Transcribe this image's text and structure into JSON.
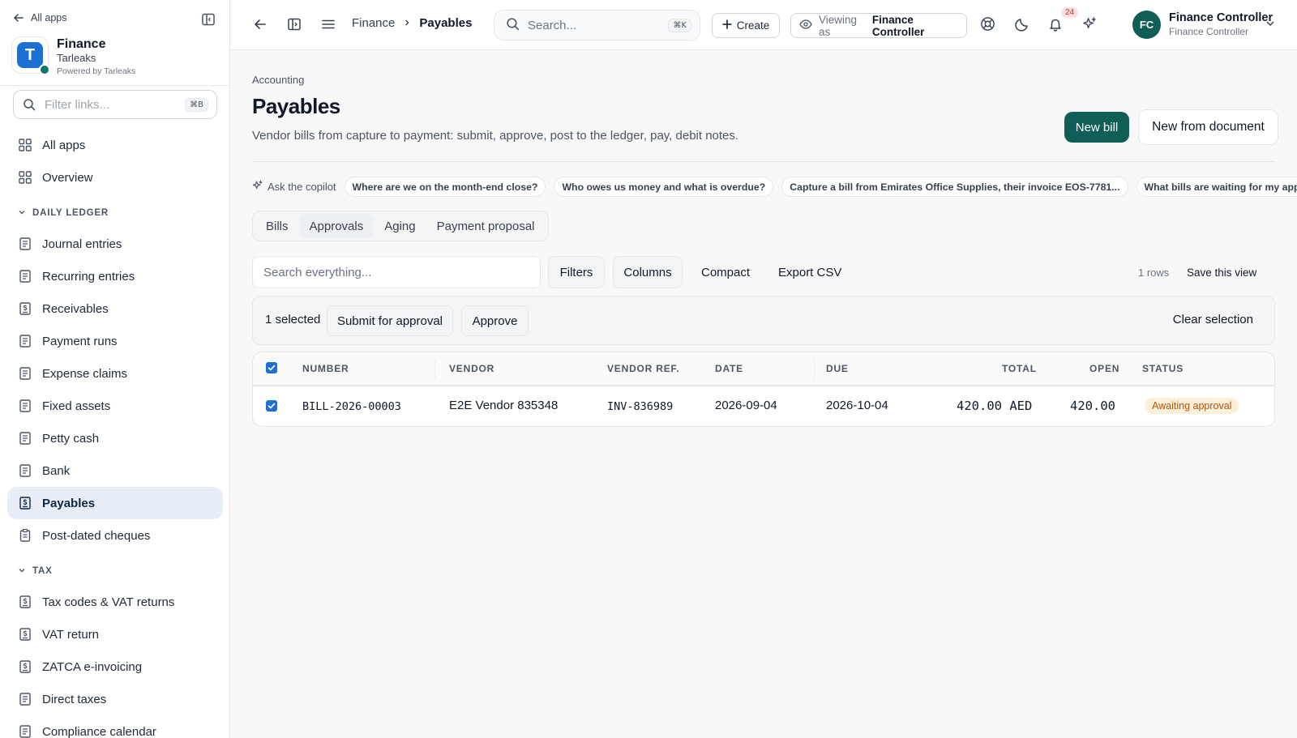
{
  "sidebar": {
    "back_label": "All apps",
    "brand": {
      "logo_letter": "T",
      "name": "Finance",
      "org": "Tarleaks",
      "powered_by": "Powered by Tarleaks"
    },
    "filter": {
      "placeholder": "Filter links...",
      "shortcut": "⌘B"
    },
    "top_items": [
      {
        "label": "All apps",
        "icon": "grid-icon"
      },
      {
        "label": "Overview",
        "icon": "grid-icon"
      }
    ],
    "sections": [
      {
        "title": "DAILY LEDGER",
        "items": [
          {
            "label": "Journal entries",
            "icon": "ledger-icon"
          },
          {
            "label": "Recurring entries",
            "icon": "ledger-icon"
          },
          {
            "label": "Receivables",
            "icon": "receipt-dollar-icon"
          },
          {
            "label": "Payment runs",
            "icon": "ledger-icon"
          },
          {
            "label": "Expense claims",
            "icon": "ledger-icon"
          },
          {
            "label": "Fixed assets",
            "icon": "ledger-icon"
          },
          {
            "label": "Petty cash",
            "icon": "ledger-icon"
          },
          {
            "label": "Bank",
            "icon": "ledger-icon"
          },
          {
            "label": "Payables",
            "icon": "receipt-dollar-icon",
            "active": true
          },
          {
            "label": "Post-dated cheques",
            "icon": "clipboard-icon"
          }
        ]
      },
      {
        "title": "TAX",
        "items": [
          {
            "label": "Tax codes & VAT returns",
            "icon": "receipt-dollar-icon"
          },
          {
            "label": "VAT return",
            "icon": "receipt-dollar-icon"
          },
          {
            "label": "ZATCA e-invoicing",
            "icon": "receipt-dollar-icon"
          },
          {
            "label": "Direct taxes",
            "icon": "ledger-icon"
          },
          {
            "label": "Compliance calendar",
            "icon": "ledger-icon"
          }
        ]
      }
    ]
  },
  "topbar": {
    "breadcrumb": {
      "parent": "Finance",
      "current": "Payables"
    },
    "search": {
      "placeholder": "Search...",
      "shortcut": "⌘K"
    },
    "create_label": "Create",
    "viewing": {
      "label": "Viewing as",
      "value": "Finance Controller"
    },
    "notifications_count": "24",
    "user": {
      "initials": "FC",
      "name": "Finance Controller",
      "role": "Finance Controller"
    }
  },
  "page": {
    "eyebrow": "Accounting",
    "title": "Payables",
    "subtitle": "Vendor bills from capture to payment: submit, approve, post to the ledger, pay, debit notes.",
    "primary_action": "New bill",
    "secondary_action": "New from document"
  },
  "copilot": {
    "label": "Ask the copilot",
    "chips": [
      "Where are we on the month-end close?",
      "Who owes us money and what is overdue?",
      "Capture a bill from Emirates Office Supplies, their invoice EOS-7781...",
      "What bills are waiting for my approval?"
    ]
  },
  "tabs": [
    "Bills",
    "Approvals",
    "Aging",
    "Payment proposal"
  ],
  "active_tab": "Approvals",
  "toolbar": {
    "search_placeholder": "Search everything...",
    "filters": "Filters",
    "columns": "Columns",
    "compact": "Compact",
    "export": "Export CSV",
    "rows_count": "1 rows",
    "save_view": "Save this view"
  },
  "selection": {
    "count_label": "1 selected",
    "submit": "Submit for approval",
    "approve": "Approve",
    "clear": "Clear selection"
  },
  "table": {
    "headers": [
      "NUMBER",
      "VENDOR",
      "VENDOR REF.",
      "DATE",
      "DUE",
      "TOTAL",
      "OPEN",
      "STATUS"
    ],
    "rows": [
      {
        "number": "BILL-2026-00003",
        "vendor": "E2E Vendor 835348",
        "vendor_ref": "INV-836989",
        "date": "2026-09-04",
        "due": "2026-10-04",
        "total": "420.00 AED",
        "open": "420.00",
        "status": "Awaiting approval",
        "selected": true
      }
    ]
  },
  "colors": {
    "accent": "#0f5f56",
    "active_nav_bg": "#e8eef8",
    "checkbox": "#1d6fd1",
    "status_bg": "#fdf0d9",
    "status_fg": "#b45309"
  }
}
